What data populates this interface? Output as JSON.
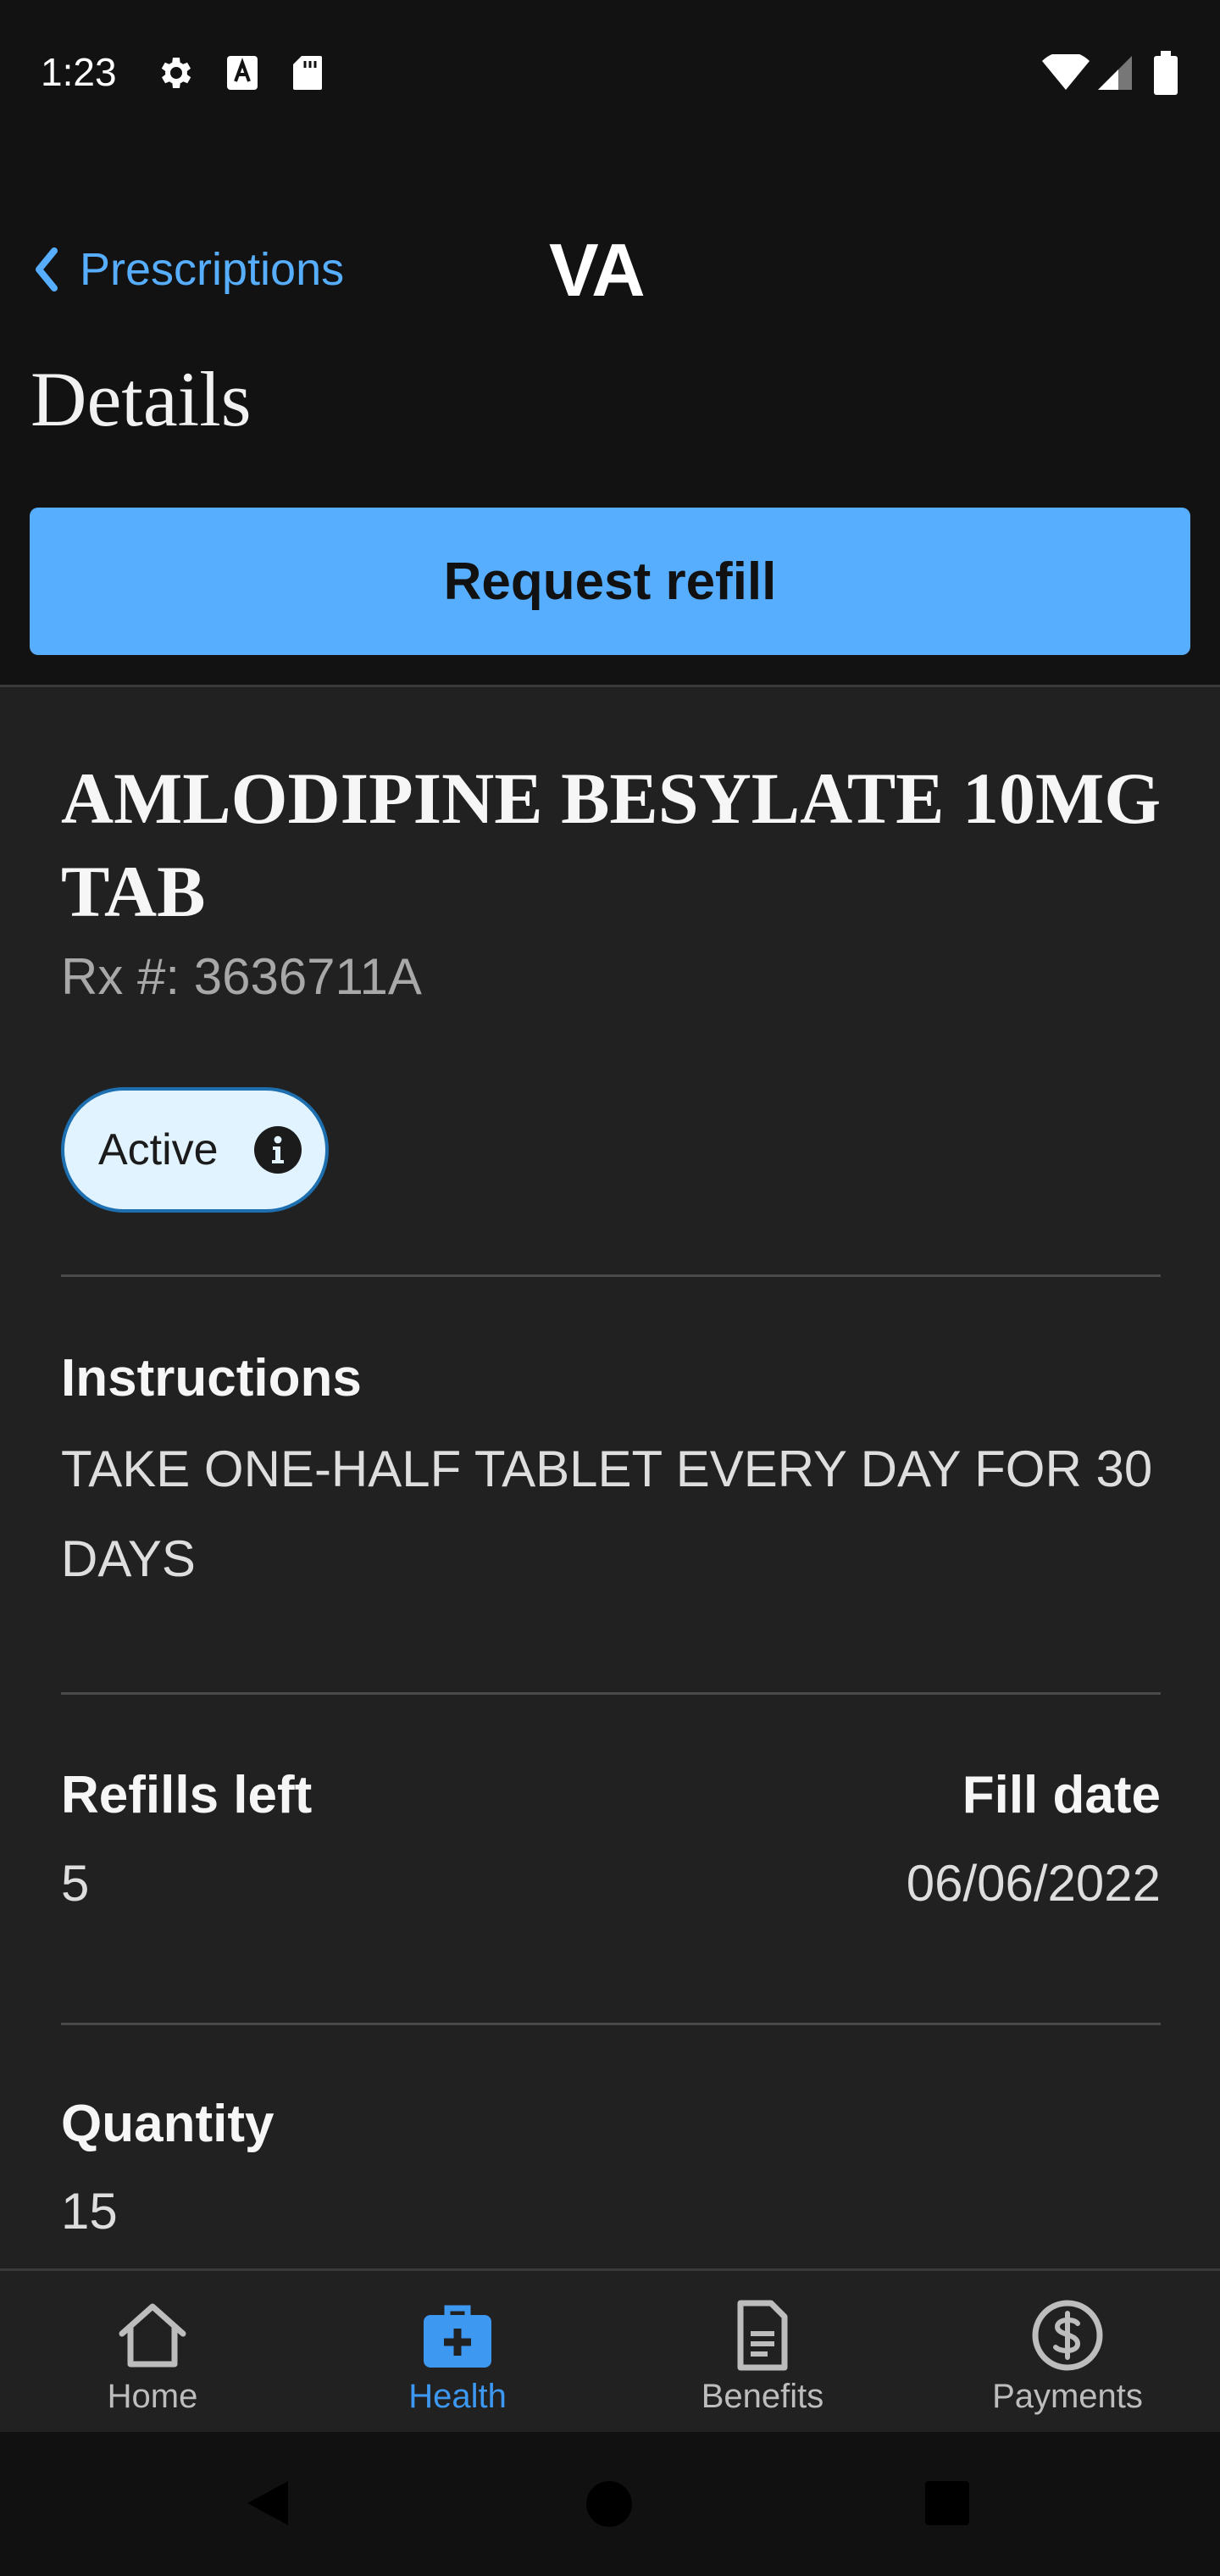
{
  "status_bar": {
    "time": "1:23",
    "icons_left": [
      "gear-icon",
      "text-a-icon",
      "sd-card-icon"
    ],
    "icons_right": [
      "wifi-icon",
      "cell-signal-icon",
      "battery-icon"
    ]
  },
  "header": {
    "back_label": "Prescriptions",
    "logo": "VA",
    "title": "Details"
  },
  "actions": {
    "request_refill_label": "Request refill"
  },
  "prescription": {
    "name": "AMLODIPINE BESYLATE 10MG TAB",
    "rx_number": "Rx #: 3636711A",
    "status": "Active",
    "instructions_label": "Instructions",
    "instructions_value": "TAKE ONE-HALF TABLET EVERY DAY FOR 30 DAYS",
    "refills_left_label": "Refills left",
    "refills_left_value": "5",
    "fill_date_label": "Fill date",
    "fill_date_value": "06/06/2022",
    "quantity_label": "Quantity",
    "quantity_value": "15"
  },
  "bottom_nav": {
    "items": [
      {
        "label": "Home",
        "icon": "home-icon",
        "active": false
      },
      {
        "label": "Health",
        "icon": "medical-kit-icon",
        "active": true
      },
      {
        "label": "Benefits",
        "icon": "document-icon",
        "active": false
      },
      {
        "label": "Payments",
        "icon": "dollar-circle-icon",
        "active": false
      }
    ]
  },
  "colors": {
    "background": "#121212",
    "surface": "#212121",
    "accent": "#57aefe",
    "active_nav": "#3d98f2",
    "pill_background": "#e1f3ff",
    "pill_border": "#1d6fb0"
  }
}
